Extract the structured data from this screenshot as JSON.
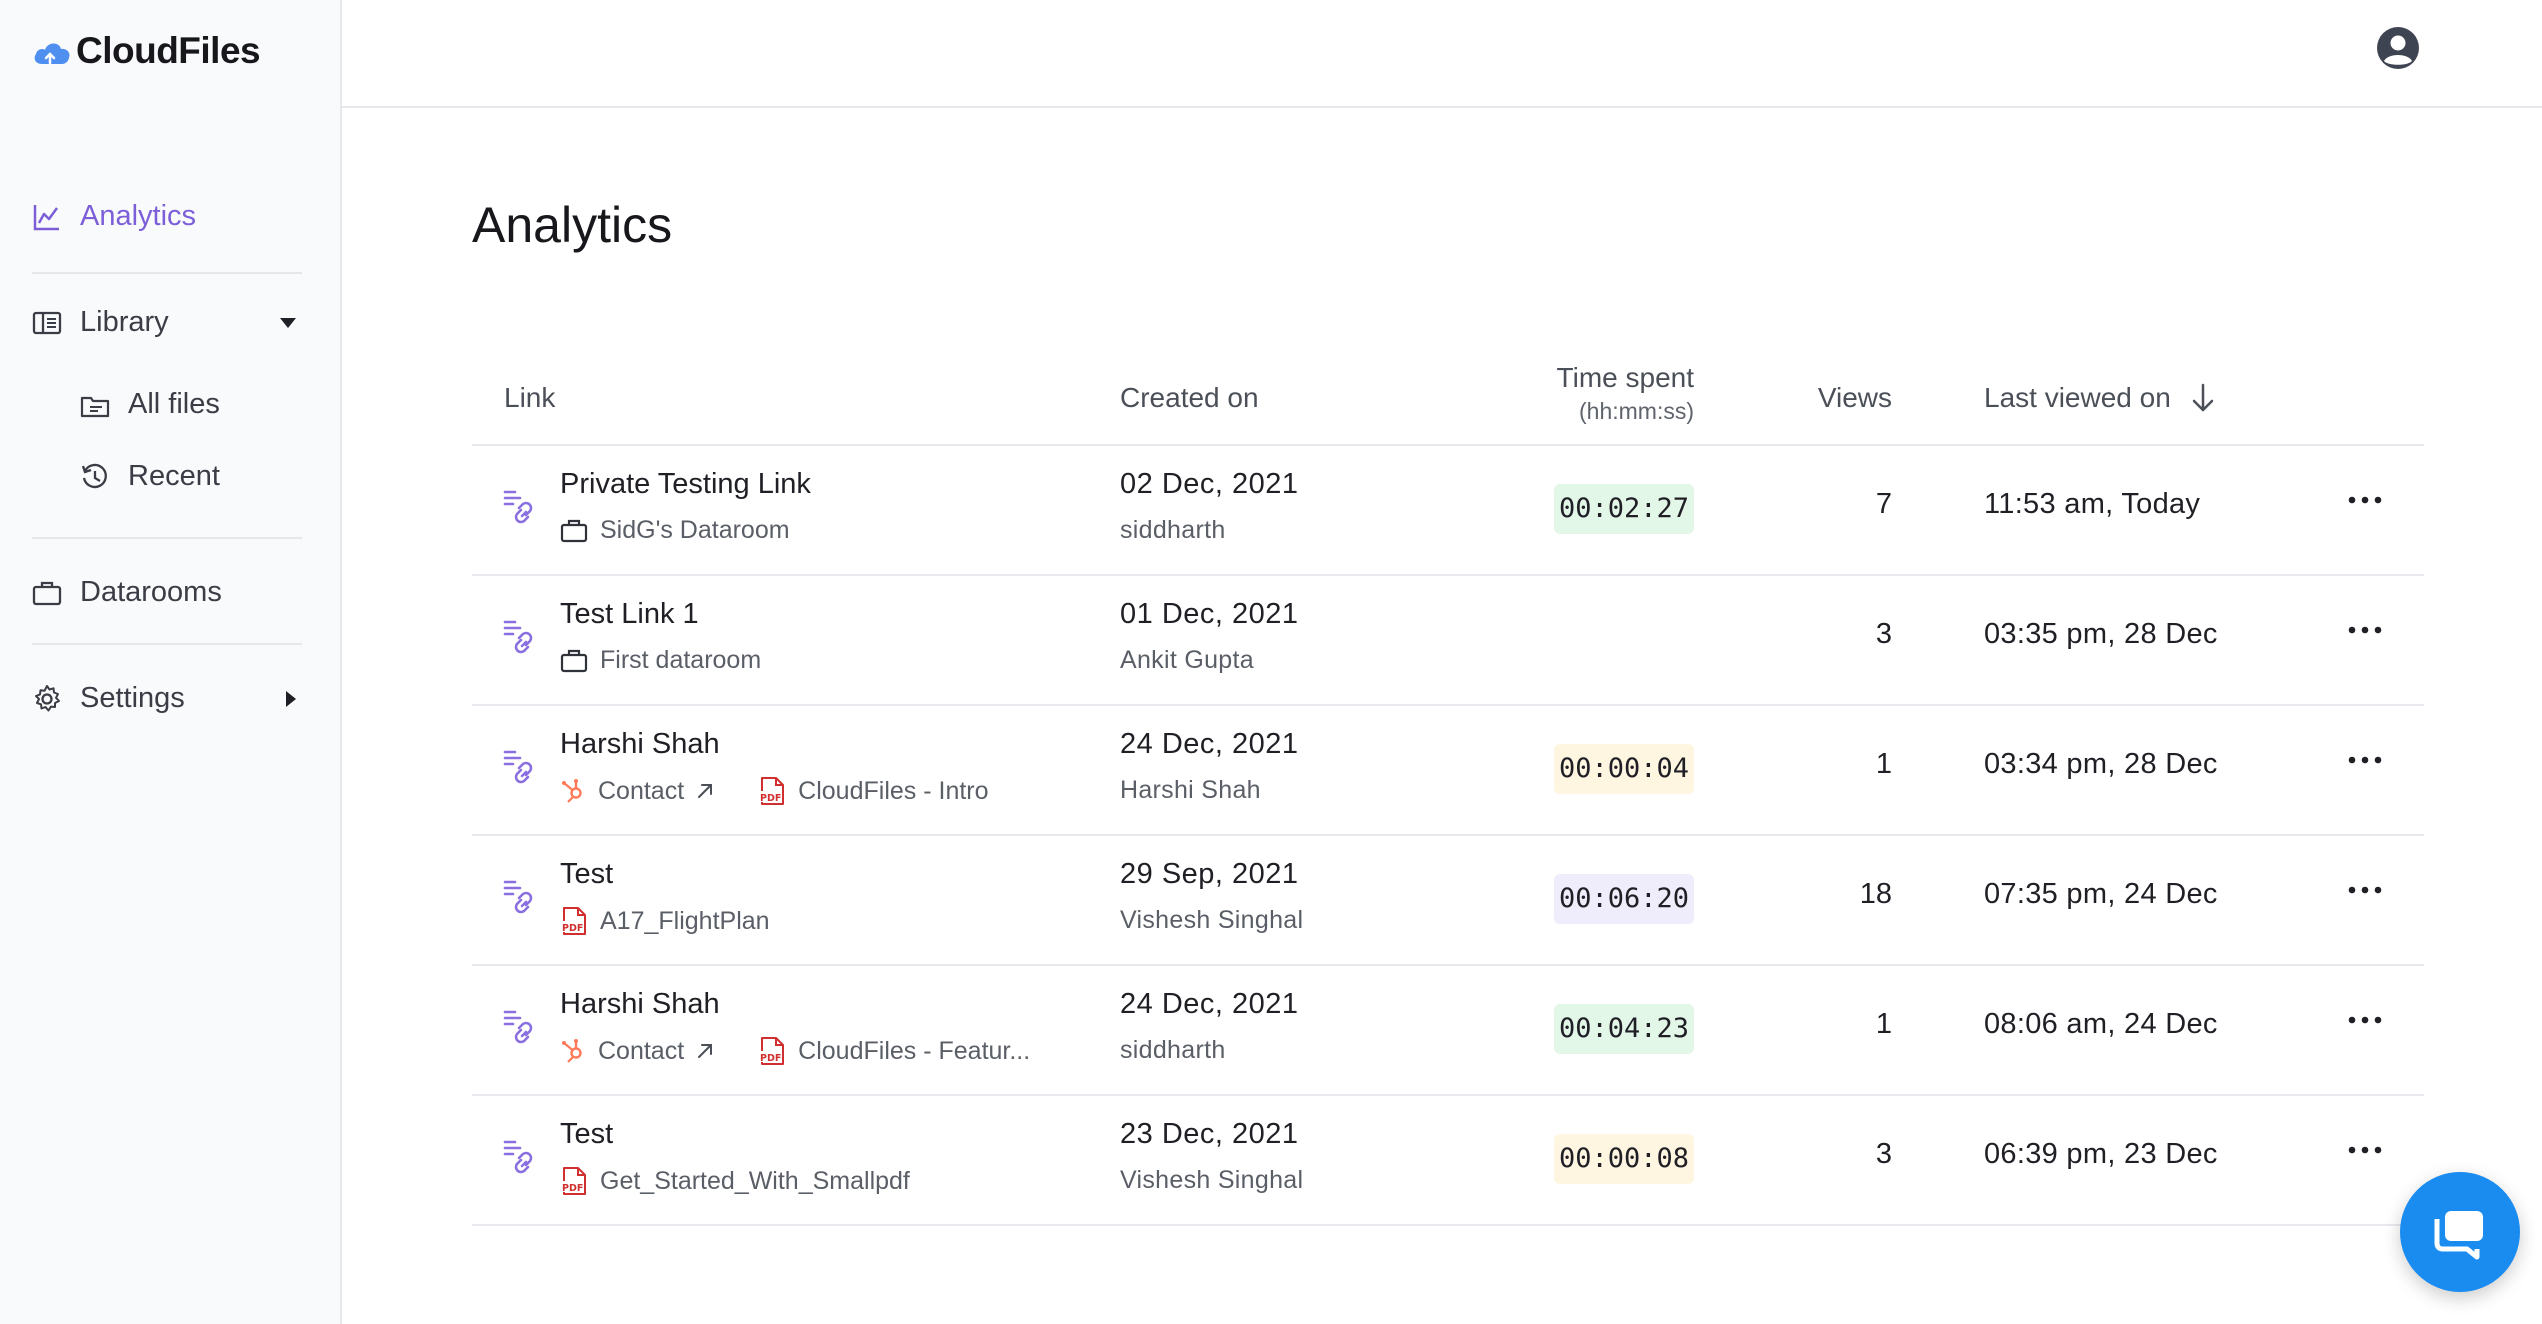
{
  "app": {
    "name": "CloudFiles"
  },
  "sidebar": {
    "analytics": "Analytics",
    "library": "Library",
    "all_files": "All files",
    "recent": "Recent",
    "datarooms": "Datarooms",
    "settings": "Settings"
  },
  "page": {
    "title": "Analytics"
  },
  "table": {
    "headers": {
      "link": "Link",
      "created_on": "Created on",
      "time_spent": "Time spent",
      "time_spent_unit": "(hh:mm:ss)",
      "views": "Views",
      "last_viewed_on": "Last viewed on"
    },
    "rows": [
      {
        "name": "Private Testing Link",
        "sub1_icon": "briefcase-icon",
        "sub1": "SidG's Dataroom",
        "sub2": "",
        "created_date": "02 Dec, 2021",
        "created_by": "siddharth",
        "time_spent": "00:02:27",
        "time_color": "#e3f7e9",
        "views": "7",
        "last_viewed": "11:53 am, Today"
      },
      {
        "name": "Test Link 1",
        "sub1_icon": "briefcase-icon",
        "sub1": "First dataroom",
        "sub2": "",
        "created_date": "01 Dec, 2021",
        "created_by": "Ankit Gupta",
        "time_spent": "",
        "time_color": "",
        "views": "3",
        "last_viewed": "03:35 pm, 28 Dec"
      },
      {
        "name": "Harshi Shah",
        "sub1_icon": "hubspot-icon",
        "sub1": "Contact",
        "sub2": "CloudFiles - Intro",
        "created_date": "24 Dec, 2021",
        "created_by": "Harshi Shah",
        "time_spent": "00:00:04",
        "time_color": "#fef6e1",
        "views": "1",
        "last_viewed": "03:34 pm, 28 Dec"
      },
      {
        "name": "Test",
        "sub1_icon": "pdf-icon",
        "sub1": "A17_FlightPlan",
        "sub2": "",
        "created_date": "29 Sep, 2021",
        "created_by": "Vishesh Singhal",
        "time_spent": "00:06:20",
        "time_color": "#efedfb",
        "views": "18",
        "last_viewed": "07:35 pm, 24 Dec"
      },
      {
        "name": "Harshi Shah",
        "sub1_icon": "hubspot-icon",
        "sub1": "Contact",
        "sub2": "CloudFiles - Featur...",
        "created_date": "24 Dec, 2021",
        "created_by": "siddharth",
        "time_spent": "00:04:23",
        "time_color": "#e3f7e9",
        "views": "1",
        "last_viewed": "08:06 am, 24 Dec"
      },
      {
        "name": "Test",
        "sub1_icon": "pdf-icon",
        "sub1": "Get_Started_With_Smallpdf",
        "sub2": "",
        "created_date": "23 Dec, 2021",
        "created_by": "Vishesh Singhal",
        "time_spent": "00:00:08",
        "time_color": "#fef6e1",
        "views": "3",
        "last_viewed": "06:39 pm, 23 Dec"
      }
    ]
  },
  "colors": {
    "accent": "#7c5fd8",
    "chat_button": "#1a8cf0"
  }
}
